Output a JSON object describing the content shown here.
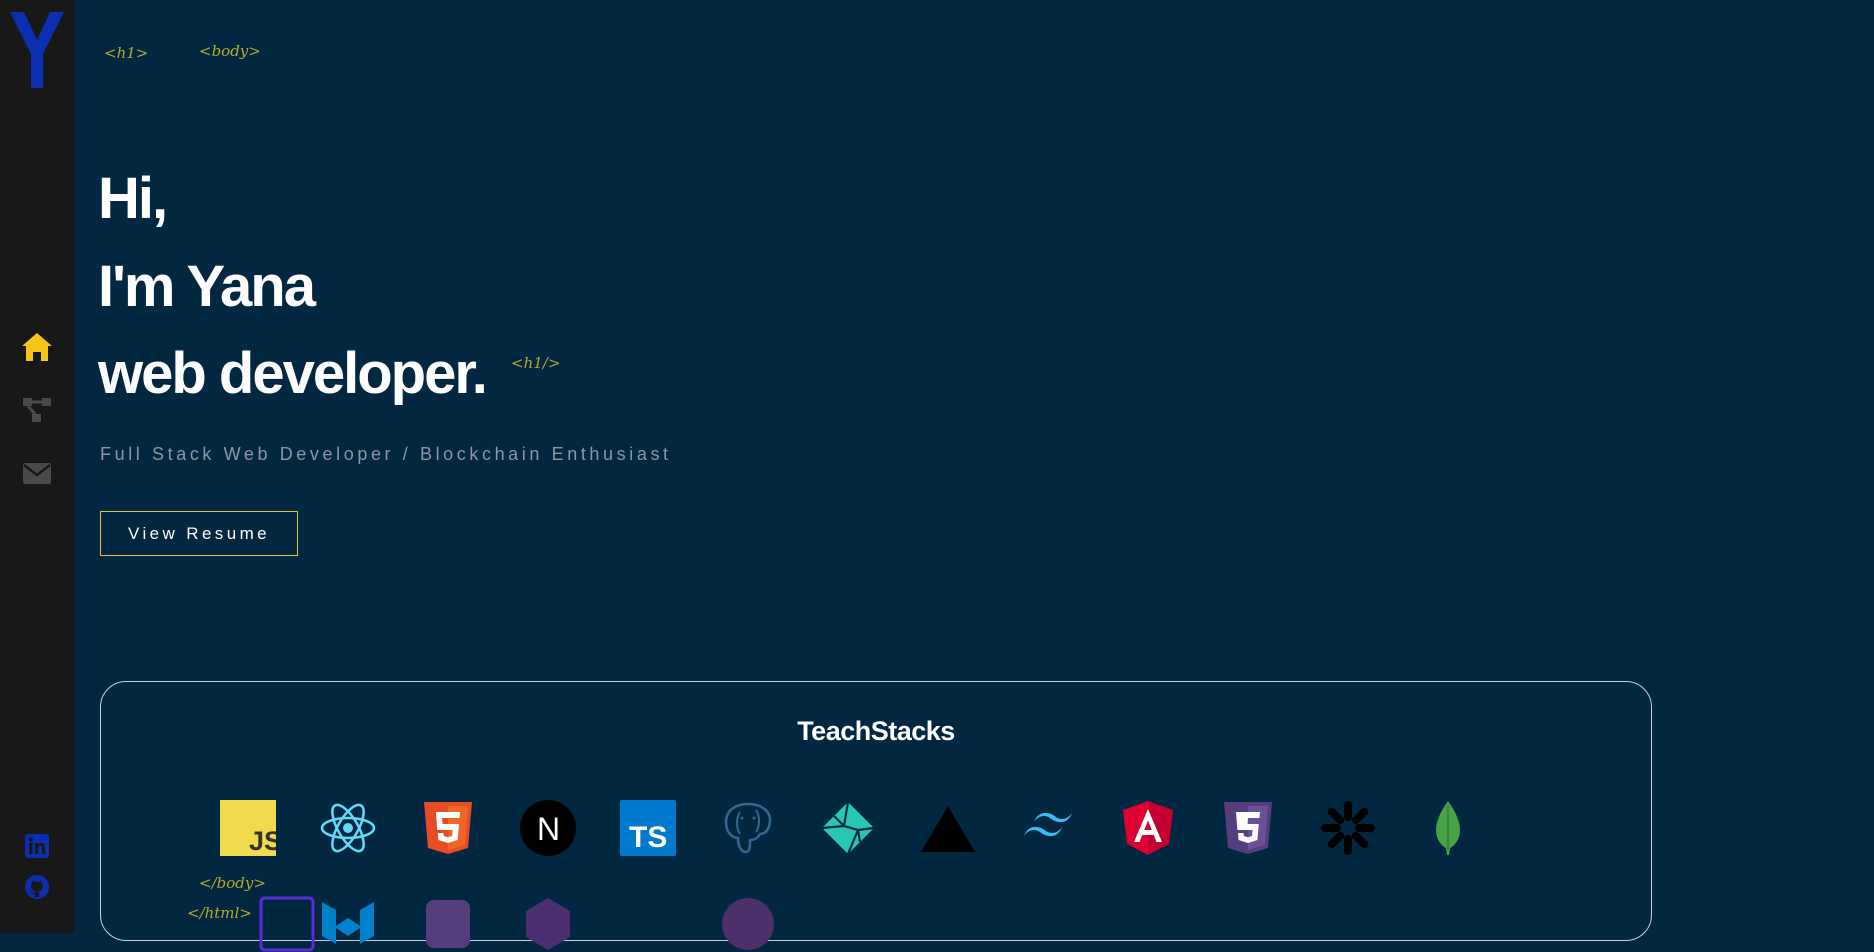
{
  "sidebar": {
    "logo_letter": "Y",
    "nav": [
      {
        "icon": "home-icon",
        "active": true
      },
      {
        "icon": "projects-icon",
        "active": false
      },
      {
        "icon": "mail-icon",
        "active": false
      }
    ],
    "social": [
      {
        "icon": "linkedin-icon"
      },
      {
        "icon": "github-icon"
      }
    ]
  },
  "decor": {
    "h1_open": "<h1>",
    "body_open": "<body>",
    "h1_close": "<h1/>",
    "body_close": "</body>",
    "html_close": "</html>"
  },
  "hero": {
    "line1": "Hi,",
    "line2": "I'm Yana",
    "line3": "web developer.",
    "subtitle": "Full Stack Web Developer / Blockchain Enthusiast",
    "resume_label": "View Resume"
  },
  "stack": {
    "title": "TeachStacks",
    "items": [
      {
        "icon": "javascript-icon",
        "label": "JS"
      },
      {
        "icon": "react-icon"
      },
      {
        "icon": "html5-icon"
      },
      {
        "icon": "nextjs-icon",
        "label": "N"
      },
      {
        "icon": "typescript-icon",
        "label": "TS"
      },
      {
        "icon": "postgresql-icon"
      },
      {
        "icon": "netlify-icon"
      },
      {
        "icon": "vercel-icon"
      },
      {
        "icon": "tailwind-icon"
      },
      {
        "icon": "angular-icon",
        "label": "A"
      },
      {
        "icon": "css3-icon"
      },
      {
        "icon": "openai-icon"
      },
      {
        "icon": "mongodb-icon"
      }
    ]
  },
  "colors": {
    "background": "#022741",
    "sidebar": "#181818",
    "accent": "#f5c518",
    "logo": "#0b2fb0",
    "tag": "#b6a92a"
  }
}
